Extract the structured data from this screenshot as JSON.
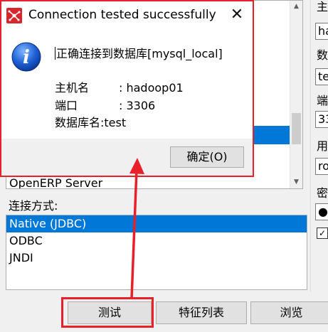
{
  "dialog": {
    "title": "Connection tested successfully",
    "message": "正确连接到数据库[mysql_local]",
    "details": [
      {
        "key": "主机名",
        "value": ": hadoop01"
      },
      {
        "key": "端口",
        "value": ": 3306"
      },
      {
        "key": "数据库名",
        "value": ":test"
      }
    ],
    "ok_label": "确定(O)",
    "close_glyph": "✕",
    "info_glyph": "i"
  },
  "connection_types": {
    "partial_item": "OpenERP Server"
  },
  "access": {
    "label": "连接方式:",
    "items": [
      {
        "label": "Native (JDBC)",
        "selected": true
      },
      {
        "label": "ODBC",
        "selected": false
      },
      {
        "label": "JNDI",
        "selected": false
      }
    ]
  },
  "right_panel": {
    "labels": [
      "主",
      "数",
      "端",
      "用",
      "密"
    ],
    "fields": [
      "ha",
      "te",
      "33",
      "ro",
      "●●"
    ],
    "checkbox_glyph": "✓"
  },
  "buttons": {
    "test": "测试",
    "features": "特征列表",
    "browse": "浏览"
  },
  "colors": {
    "selection": "#0078d7",
    "annotation": "#e8202a",
    "app_icon": "#d8262e"
  }
}
